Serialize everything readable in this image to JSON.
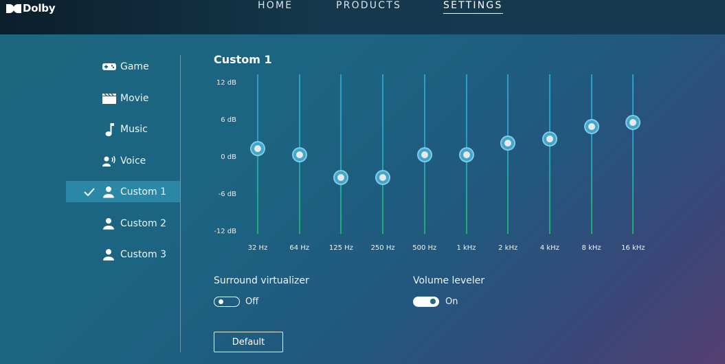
{
  "brand": {
    "name": "Dolby"
  },
  "nav": [
    {
      "label": "HOME",
      "active": false
    },
    {
      "label": "PRODUCTS",
      "active": false
    },
    {
      "label": "SETTINGS",
      "active": true
    }
  ],
  "sidebar": {
    "items": [
      {
        "label": "Game",
        "icon": "gamepad-icon",
        "selected": false
      },
      {
        "label": "Movie",
        "icon": "clapperboard-icon",
        "selected": false
      },
      {
        "label": "Music",
        "icon": "music-note-icon",
        "selected": false
      },
      {
        "label": "Voice",
        "icon": "voice-icon",
        "selected": false
      },
      {
        "label": "Custom 1",
        "icon": "person-icon",
        "selected": true
      },
      {
        "label": "Custom 2",
        "icon": "person-icon",
        "selected": false
      },
      {
        "label": "Custom 3",
        "icon": "person-icon",
        "selected": false
      }
    ]
  },
  "equalizer": {
    "title": "Custom 1",
    "db_labels": [
      "12 dB",
      "6 dB",
      "0 dB",
      "-6 dB",
      "-12 dB"
    ],
    "range_db": [
      -12,
      12
    ],
    "bands": [
      {
        "freq": "32 Hz",
        "gain_db": 1.5
      },
      {
        "freq": "64 Hz",
        "gain_db": 0.5
      },
      {
        "freq": "125 Hz",
        "gain_db": -3.2
      },
      {
        "freq": "250 Hz",
        "gain_db": -3.2
      },
      {
        "freq": "500 Hz",
        "gain_db": 0.5
      },
      {
        "freq": "1 kHz",
        "gain_db": 0.5
      },
      {
        "freq": "2 kHz",
        "gain_db": 2.3
      },
      {
        "freq": "4 kHz",
        "gain_db": 3.0
      },
      {
        "freq": "8 kHz",
        "gain_db": 5.0
      },
      {
        "freq": "16 kHz",
        "gain_db": 5.7
      }
    ]
  },
  "options": {
    "surround": {
      "label": "Surround virtualizer",
      "state": "Off"
    },
    "leveler": {
      "label": "Volume leveler",
      "state": "On"
    }
  },
  "default_button": {
    "label": "Default"
  },
  "colors": {
    "accent": "#2a87a6",
    "knob": "#3fa6cc",
    "track_top": "#2a9fc8",
    "track_bottom": "#1fae6e"
  }
}
